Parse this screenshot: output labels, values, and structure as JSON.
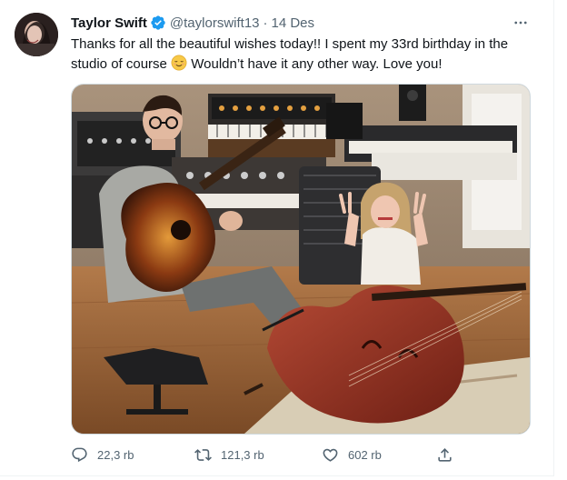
{
  "author": {
    "name": "Taylor Swift",
    "handle": "@taylorswift13",
    "separator": "·",
    "date": "14 Des",
    "verified": true
  },
  "tweet": {
    "line1": "Thanks for all the beautiful wishes today!! I spent my 33rd birthday in the",
    "line2a": "studio of course",
    "emoji_name": "relieved-face-icon",
    "line2b": "Wouldn’t have it any other way. Love you!"
  },
  "media": {
    "alt": "Studio photo with a guitarist and a double bass"
  },
  "actions": {
    "reply_count": "22,3 rb",
    "retweet_count": "121,3 rb",
    "like_count": "602 rb"
  },
  "colors": {
    "text": "#0f1419",
    "secondary": "#536471",
    "verified": "#1d9bf0",
    "border": "#cfd9de"
  }
}
